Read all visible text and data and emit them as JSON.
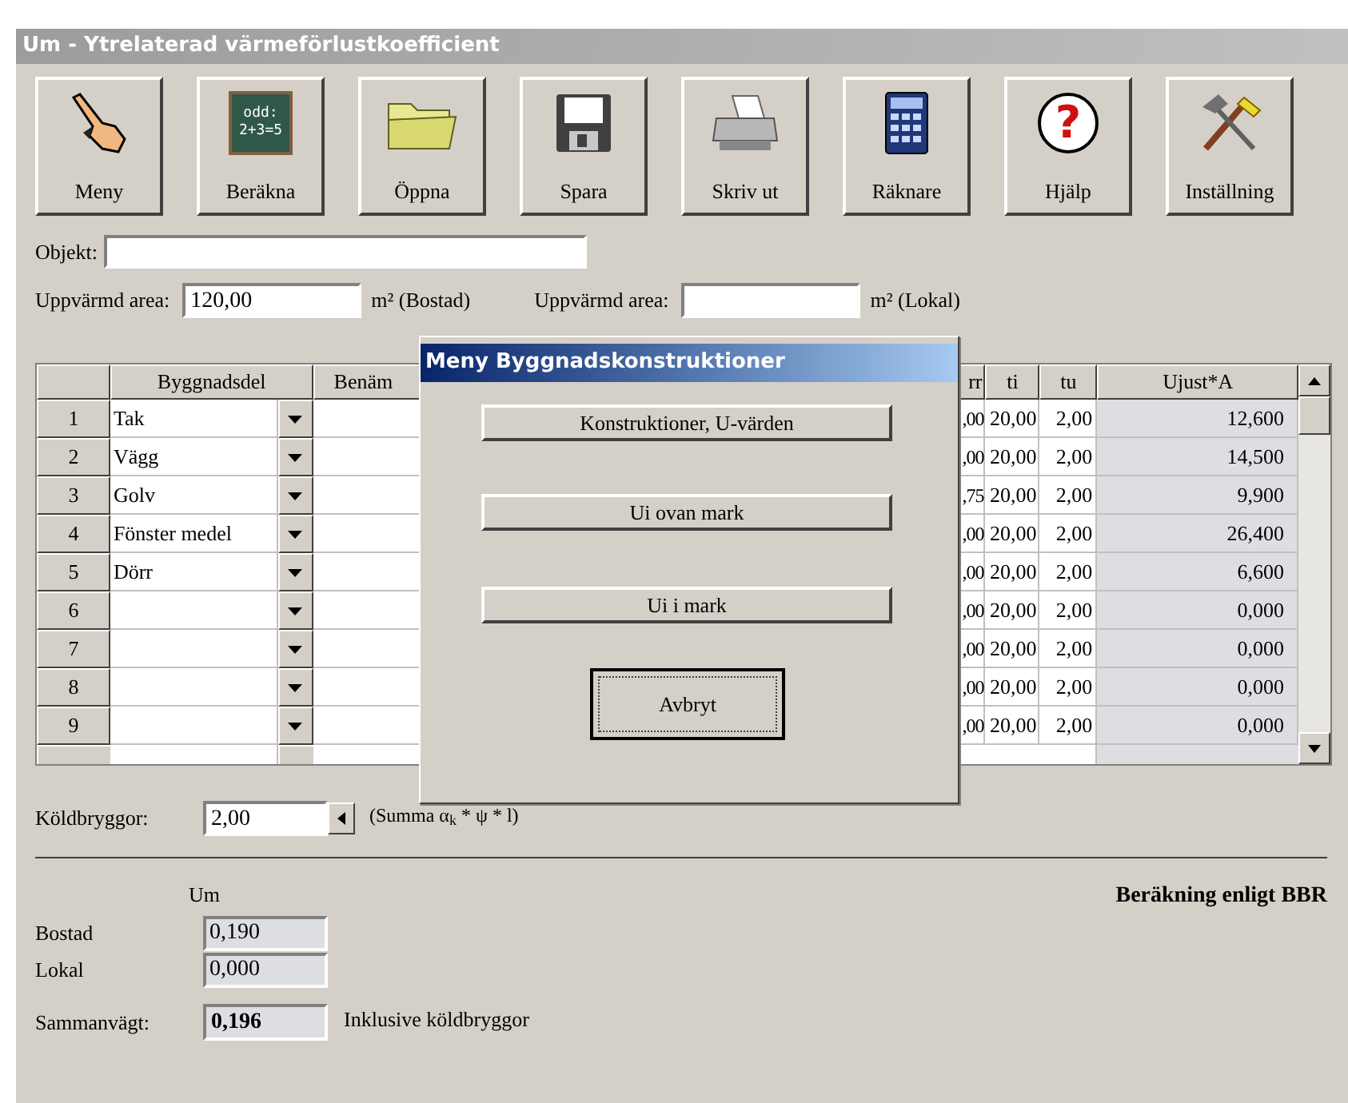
{
  "window": {
    "title": "Um - Ytrelaterad värmeförlustkoefficient"
  },
  "toolbar": [
    {
      "label": "Meny",
      "kind": "hand"
    },
    {
      "label": "Beräkna",
      "kind": "board",
      "board_text": [
        "odd:",
        "2+3=5"
      ]
    },
    {
      "label": "Öppna",
      "kind": "folder"
    },
    {
      "label": "Spara",
      "kind": "floppy"
    },
    {
      "label": "Skriv ut",
      "kind": "printer"
    },
    {
      "label": "Räknare",
      "kind": "calculator"
    },
    {
      "label": "Hjälp",
      "kind": "help",
      "glyph": "?"
    },
    {
      "label": "Inställning",
      "kind": "tools"
    }
  ],
  "objekt": {
    "label": "Objekt:"
  },
  "areas": [
    {
      "label": "Uppvärmd area:",
      "value": "120,00",
      "unit": "m² (Bostad)"
    },
    {
      "label": "Uppvärmd area:",
      "unit": "m² (Lokal)"
    }
  ],
  "grid": {
    "columns": [
      "Byggnadsdel",
      "Benäm",
      "rr",
      "ti",
      "tu",
      "Ujust*A"
    ],
    "rows": [
      {
        "number": "1",
        "byggnadsdel": "Tak",
        "column_3": ",00",
        "ti": "20,00",
        "tu": "2,00",
        "ujust_a": "12,600"
      },
      {
        "number": "2",
        "byggnadsdel": "Vägg",
        "column_3": ",00",
        "ti": "20,00",
        "tu": "2,00",
        "ujust_a": "14,500"
      },
      {
        "number": "3",
        "byggnadsdel": "Golv",
        "column_3": ",75",
        "ti": "20,00",
        "tu": "2,00",
        "ujust_a": "9,900"
      },
      {
        "number": "4",
        "byggnadsdel": "Fönster medel",
        "column_3": ",00",
        "ti": "20,00",
        "tu": "2,00",
        "ujust_a": "26,400"
      },
      {
        "number": "5",
        "byggnadsdel": "Dörr",
        "column_3": ",00",
        "ti": "20,00",
        "tu": "2,00",
        "ujust_a": "6,600"
      },
      {
        "number": "6",
        "column_3": ",00",
        "ti": "20,00",
        "tu": "2,00",
        "ujust_a": "0,000"
      },
      {
        "number": "7",
        "column_3": ",00",
        "ti": "20,00",
        "tu": "2,00",
        "ujust_a": "0,000"
      },
      {
        "number": "8",
        "column_3": ",00",
        "ti": "20,00",
        "tu": "2,00",
        "ujust_a": "0,000"
      },
      {
        "number": "9",
        "column_3": ",00",
        "ti": "20,00",
        "tu": "2,00",
        "ujust_a": "0,000"
      }
    ]
  },
  "koldbryggor": {
    "label": "Köldbryggor:",
    "value": "2,00",
    "formula": "(Summa α$_{k}$ * ψ * l)"
  },
  "results": {
    "column_header": "Um",
    "method": "Beräkning enligt BBR",
    "rows": [
      {
        "label": "Bostad",
        "value": "0,190"
      },
      {
        "label": "Lokal",
        "value": "0,000"
      }
    ],
    "total": {
      "label": "Sammanvägt:",
      "value": "0,196",
      "note": "Inklusive köldbryggor"
    }
  },
  "dialog": {
    "title": "Meny Byggnadskonstruktioner",
    "buttons": [
      {
        "label": "Konstruktioner, U-värden",
        "kind": "normal"
      },
      {
        "label": "Ui ovan mark",
        "kind": "normal"
      },
      {
        "label": "Ui i mark",
        "kind": "normal"
      },
      {
        "label": "Avbryt",
        "kind": "default"
      }
    ]
  }
}
